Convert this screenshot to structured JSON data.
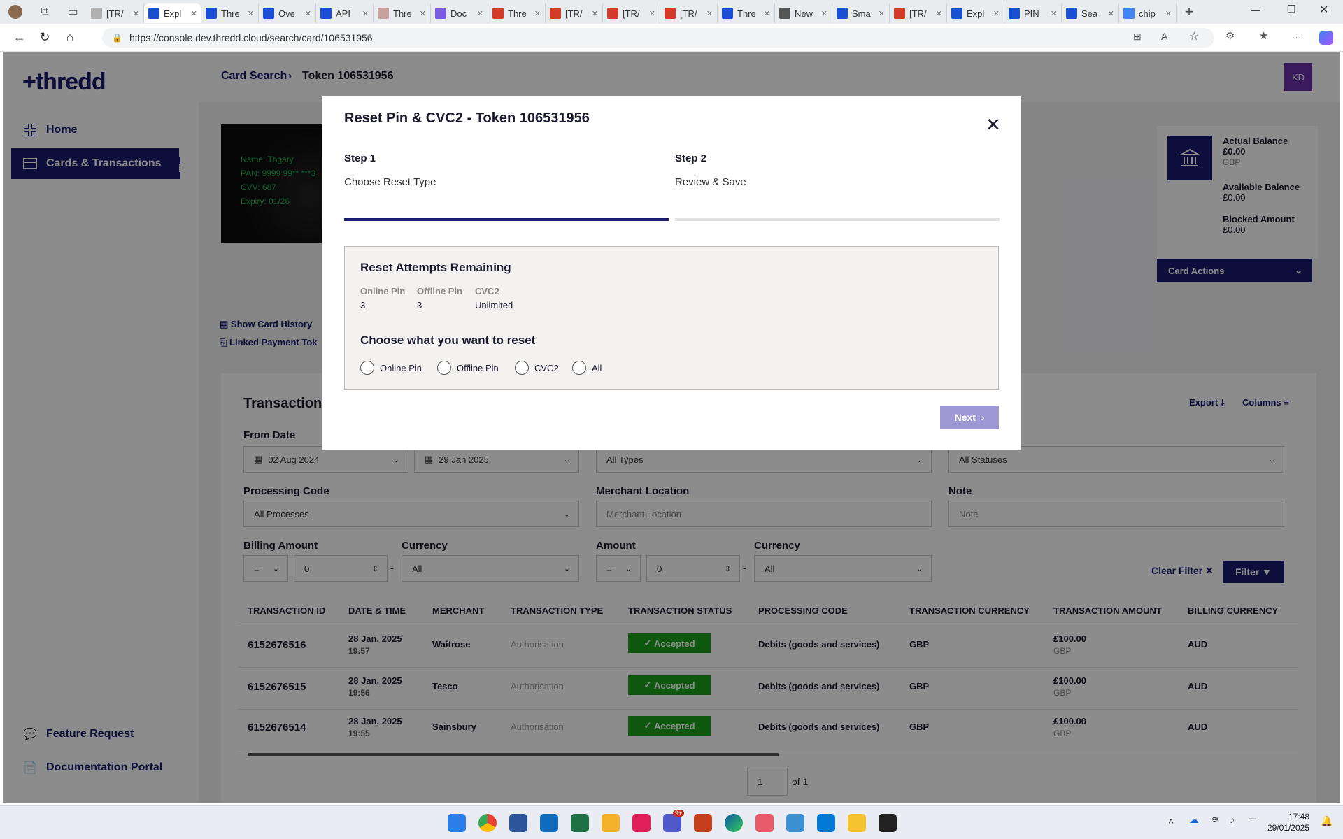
{
  "browser": {
    "tabs": [
      {
        "title": "[TR/",
        "color": "#b0b0b0"
      },
      {
        "title": "Expl",
        "color": "#1b4fd1",
        "active": true
      },
      {
        "title": "Thre",
        "color": "#1b4fd1"
      },
      {
        "title": "Ove",
        "color": "#1b4fd1"
      },
      {
        "title": "API",
        "color": "#1b4fd1"
      },
      {
        "title": "Thre",
        "color": "#c9a0a0"
      },
      {
        "title": "Doc",
        "color": "#7a5ce0"
      },
      {
        "title": "Thre",
        "color": "#d23a2a"
      },
      {
        "title": "[TR/",
        "color": "#d23a2a"
      },
      {
        "title": "[TR/",
        "color": "#d23a2a"
      },
      {
        "title": "[TR/",
        "color": "#d23a2a"
      },
      {
        "title": "Thre",
        "color": "#1b4fd1"
      },
      {
        "title": "New",
        "color": "#555555"
      },
      {
        "title": "Sma",
        "color": "#1b4fd1"
      },
      {
        "title": "[TR/",
        "color": "#d23a2a"
      },
      {
        "title": "Expl",
        "color": "#1b4fd1"
      },
      {
        "title": "PIN",
        "color": "#1b4fd1"
      },
      {
        "title": "Sea",
        "color": "#1b4fd1"
      },
      {
        "title": "chip",
        "color": "#4285f4"
      }
    ],
    "url": "https://console.dev.thredd.cloud/search/card/106531956"
  },
  "app": {
    "logo": "+thredd",
    "nav": [
      {
        "label": "Home",
        "icon": "grid-icon"
      },
      {
        "label": "Cards & Transactions",
        "icon": "card-icon",
        "active": true
      }
    ],
    "nav_bottom": [
      {
        "label": "Feature Request",
        "icon": "comment-icon"
      },
      {
        "label": "Documentation Portal",
        "icon": "document-icon"
      }
    ],
    "breadcrumb": {
      "root": "Card Search",
      "current": "Token 106531956"
    },
    "avatar": "KD",
    "card": {
      "name": "Name: Thgary",
      "pan": "PAN: 9999 99** ***3",
      "cvv": "CVV: 687",
      "expiry": "Expiry: 01/26"
    },
    "links": {
      "history": "Show Card History",
      "linked": "Linked Payment Tok"
    },
    "balance": {
      "actual_label": "Actual Balance",
      "actual_value": "£0.00",
      "actual_currency": "GBP",
      "available_label": "Available Balance",
      "available_value": "£0.00",
      "blocked_label": "Blocked Amount",
      "blocked_value": "£0.00"
    },
    "card_actions": "Card Actions",
    "transactions": {
      "title": "Transaction",
      "export": "Export",
      "columns": "Columns",
      "from_date_label": "From Date",
      "from_date": "02 Aug 2024",
      "to_date": "29 Jan 2025",
      "types": "All Types",
      "statuses": "All Statuses",
      "processing_code_label": "Processing Code",
      "processing_code": "All Processes",
      "merchant_location_label": "Merchant Location",
      "merchant_location_placeholder": "Merchant Location",
      "note_label": "Note",
      "note_placeholder": "Note",
      "billing_amount_label": "Billing Amount",
      "billing_op": "=",
      "billing_value": "0",
      "currency_label": "Currency",
      "currency": "All",
      "amount_label": "Amount",
      "amount_op": "=",
      "amount_value": "0",
      "currency2_label": "Currency",
      "currency2": "All",
      "clear_filter": "Clear Filter",
      "filter": "Filter",
      "headers": [
        "TRANSACTION ID",
        "DATE & TIME",
        "MERCHANT",
        "TRANSACTION TYPE",
        "TRANSACTION STATUS",
        "PROCESSING CODE",
        "TRANSACTION CURRENCY",
        "TRANSACTION AMOUNT",
        "BILLING CURRENCY"
      ],
      "rows": [
        {
          "id": "6152676516",
          "date": "28 Jan, 2025",
          "time": "19:57",
          "merchant": "Waitrose",
          "type": "Authorisation",
          "status": "Accepted",
          "code": "Debits (goods and services)",
          "currency": "GBP",
          "amount": "£100.00",
          "amount_ccy": "GBP",
          "billing": "AUD"
        },
        {
          "id": "6152676515",
          "date": "28 Jan, 2025",
          "time": "19:56",
          "merchant": "Tesco",
          "type": "Authorisation",
          "status": "Accepted",
          "code": "Debits (goods and services)",
          "currency": "GBP",
          "amount": "£100.00",
          "amount_ccy": "GBP",
          "billing": "AUD"
        },
        {
          "id": "6152676514",
          "date": "28 Jan, 2025",
          "time": "19:55",
          "merchant": "Sainsbury",
          "type": "Authorisation",
          "status": "Accepted",
          "code": "Debits (goods and services)",
          "currency": "GBP",
          "amount": "£100.00",
          "amount_ccy": "GBP",
          "billing": "AUD"
        }
      ],
      "page": "1",
      "page_of": "of 1"
    }
  },
  "modal": {
    "title": "Reset Pin & CVC2 - Token 106531956",
    "step1_head": "Step 1",
    "step1_sub": "Choose Reset Type",
    "step2_head": "Step 2",
    "step2_sub": "Review & Save",
    "attempts_title": "Reset Attempts Remaining",
    "online_pin_label": "Online Pin",
    "online_pin_value": "3",
    "offline_pin_label": "Offline Pin",
    "offline_pin_value": "3",
    "cvc2_label": "CVC2",
    "cvc2_value": "Unlimited",
    "choose_title": "Choose what you want to reset",
    "options": [
      "Online Pin",
      "Offline Pin",
      "CVC2",
      "All"
    ],
    "next": "Next"
  },
  "taskbar": {
    "time": "17:48",
    "date": "29/01/2025",
    "badge": "9+"
  },
  "colors": {
    "brand": "#1b1b6e",
    "accepted": "#1a9e1a",
    "next_disabled": "#9d97d4"
  }
}
